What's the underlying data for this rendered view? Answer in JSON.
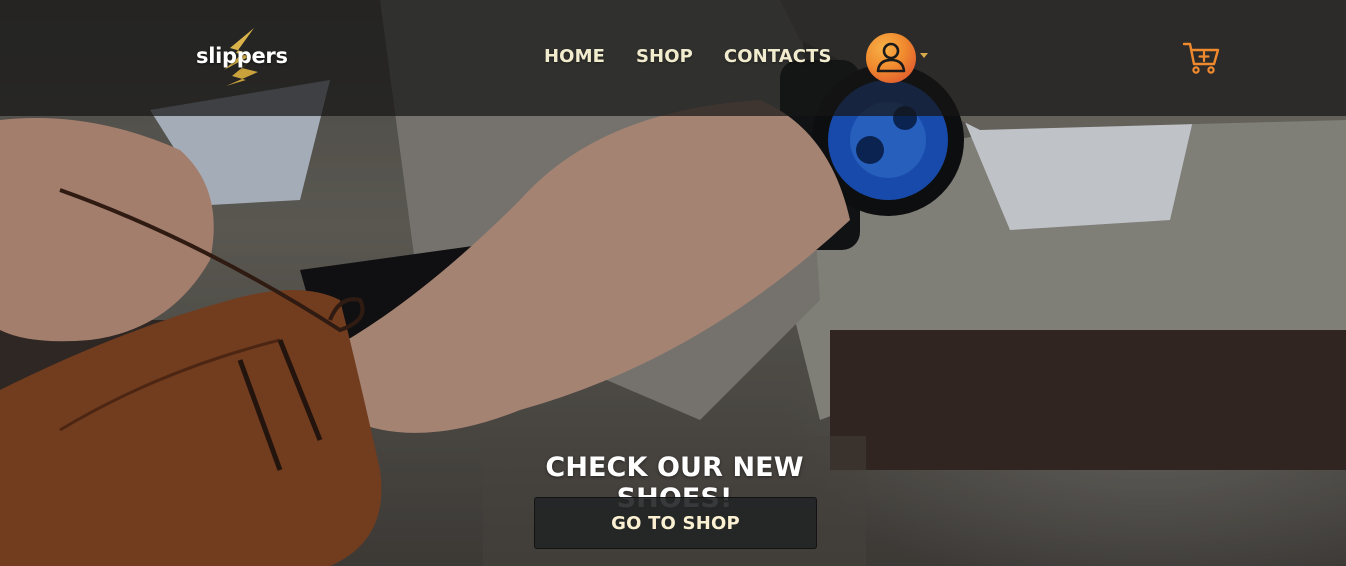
{
  "brand": {
    "name": "slippers",
    "logo_icon": "lightning-s-logo-icon",
    "logo_color": "#d9b34a"
  },
  "nav": {
    "items": [
      {
        "label": "HOME"
      },
      {
        "label": "SHOP"
      },
      {
        "label": "CONTACTS"
      }
    ],
    "link_color": "#f2eccf"
  },
  "account": {
    "icon": "user-icon",
    "avatar_color": "#f08a2e",
    "dropdown_icon": "caret-down-icon"
  },
  "cart": {
    "icon": "shopping-cart-add-icon",
    "color": "#f08a2e"
  },
  "hero": {
    "image": "hands-tying-brown-leather-shoe-laces",
    "headline": "CHECK OUR NEW SHOES!",
    "button_label": "GO TO SHOP"
  }
}
